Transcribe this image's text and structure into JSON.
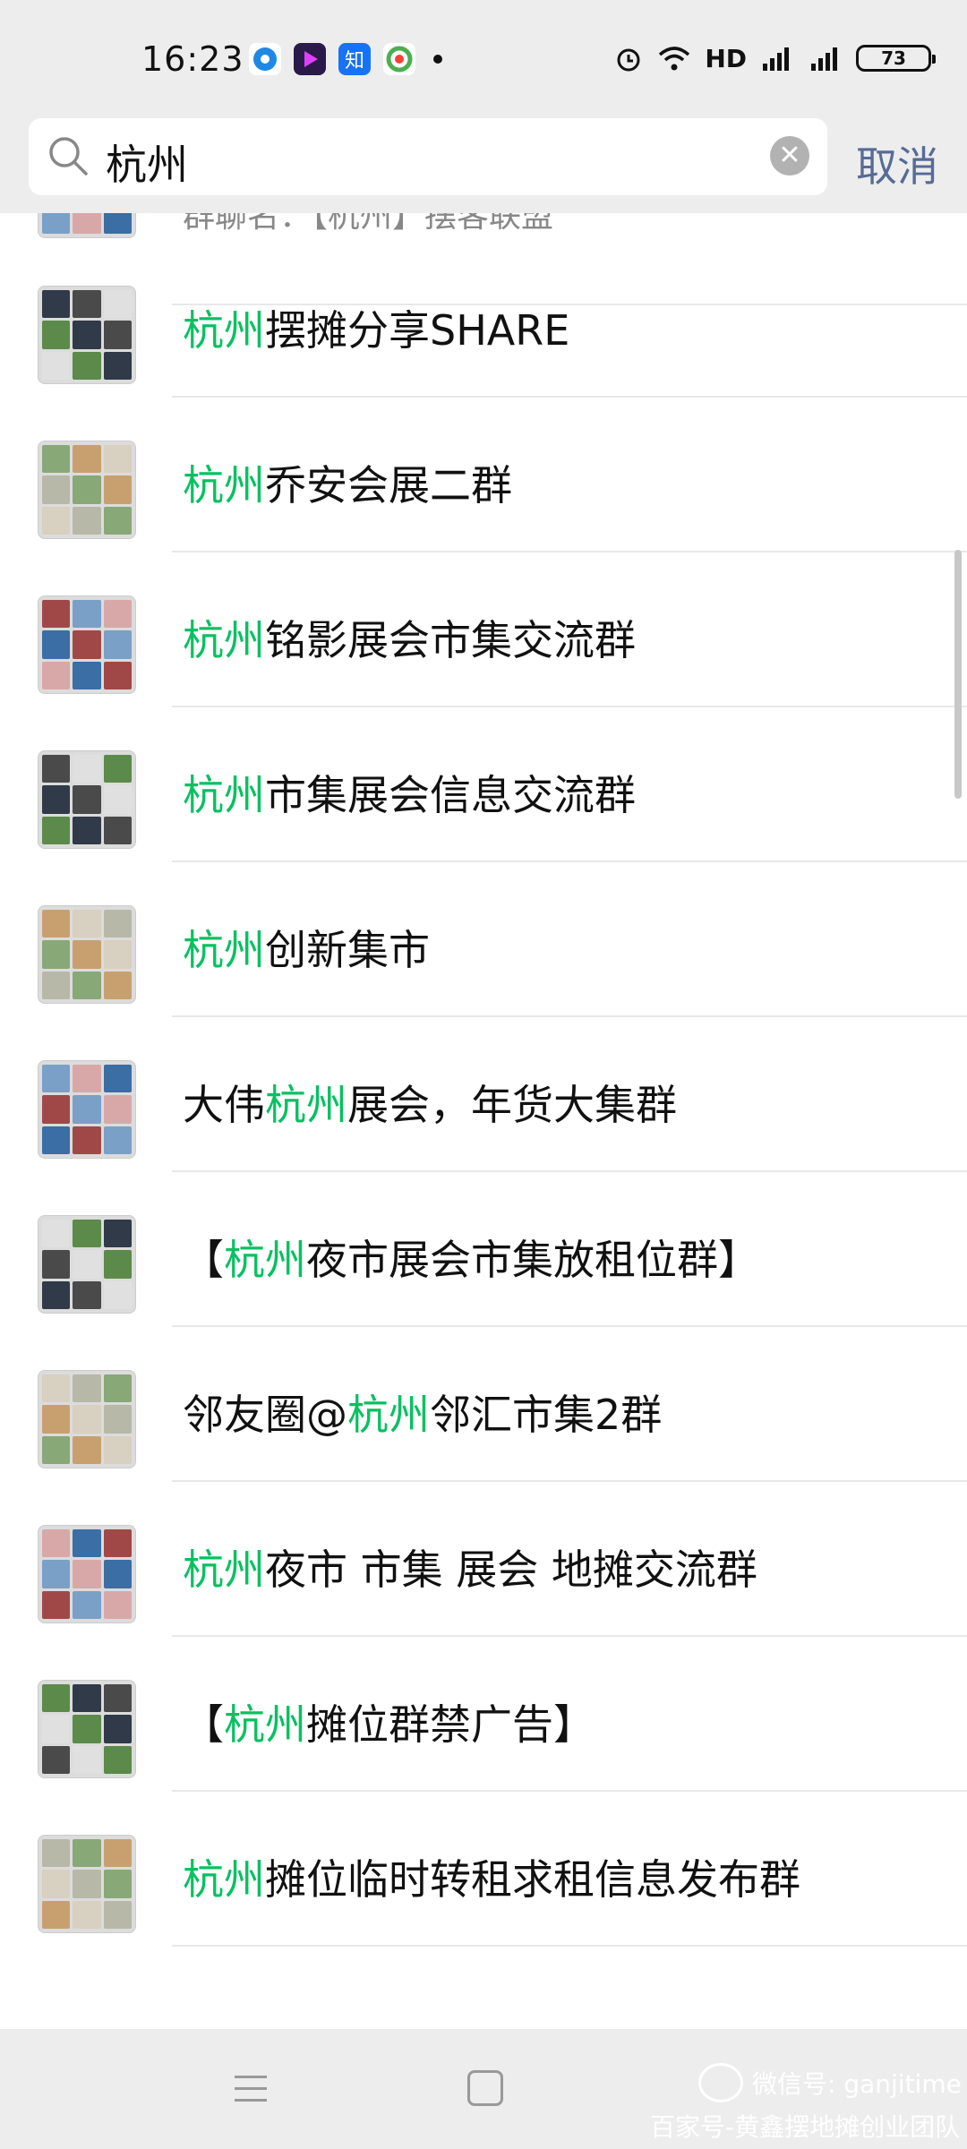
{
  "status_bar": {
    "time": "16:23",
    "network": "HD",
    "battery": "73"
  },
  "search": {
    "query": "杭州",
    "cancel_label": "取消"
  },
  "results": [
    {
      "parts": [
        "【",
        "杭州",
        "】摆客联盟【不】"
      ],
      "highlight": [
        false,
        true,
        false
      ],
      "subtitle": "群聊名：【杭州】摆客联盟"
    },
    {
      "parts": [
        "杭州",
        "摆摊分享SHARE"
      ],
      "highlight": [
        true,
        false
      ]
    },
    {
      "parts": [
        "杭州",
        "乔安会展二群"
      ],
      "highlight": [
        true,
        false
      ]
    },
    {
      "parts": [
        "杭州",
        "铭影展会市集交流群"
      ],
      "highlight": [
        true,
        false
      ]
    },
    {
      "parts": [
        "杭州",
        "市集展会信息交流群"
      ],
      "highlight": [
        true,
        false
      ]
    },
    {
      "parts": [
        "杭州",
        "创新集市"
      ],
      "highlight": [
        true,
        false
      ]
    },
    {
      "parts": [
        "大伟",
        "杭州",
        "展会，年货大集群"
      ],
      "highlight": [
        false,
        true,
        false
      ]
    },
    {
      "parts": [
        "【",
        "杭州",
        "夜市展会市集放租位群】"
      ],
      "highlight": [
        false,
        true,
        false
      ]
    },
    {
      "parts": [
        "邻友圈@",
        "杭州",
        "邻汇市集2群"
      ],
      "highlight": [
        false,
        true,
        false
      ]
    },
    {
      "parts": [
        "杭州",
        "夜市 市集 展会 地摊交流群"
      ],
      "highlight": [
        true,
        false
      ]
    },
    {
      "parts": [
        "【",
        "杭州",
        "摊位群禁广告】"
      ],
      "highlight": [
        false,
        true,
        false
      ]
    },
    {
      "parts": [
        "杭州",
        "摊位临时转租求租信息发布群"
      ],
      "highlight": [
        true,
        false
      ]
    }
  ],
  "watermark": {
    "line1": "微信号: ganjitime",
    "line2": "百家号-黄鑫摆地摊创业团队"
  },
  "colors": {
    "highlight": "#07c160",
    "cancel": "#576b95",
    "background": "#ededed"
  }
}
